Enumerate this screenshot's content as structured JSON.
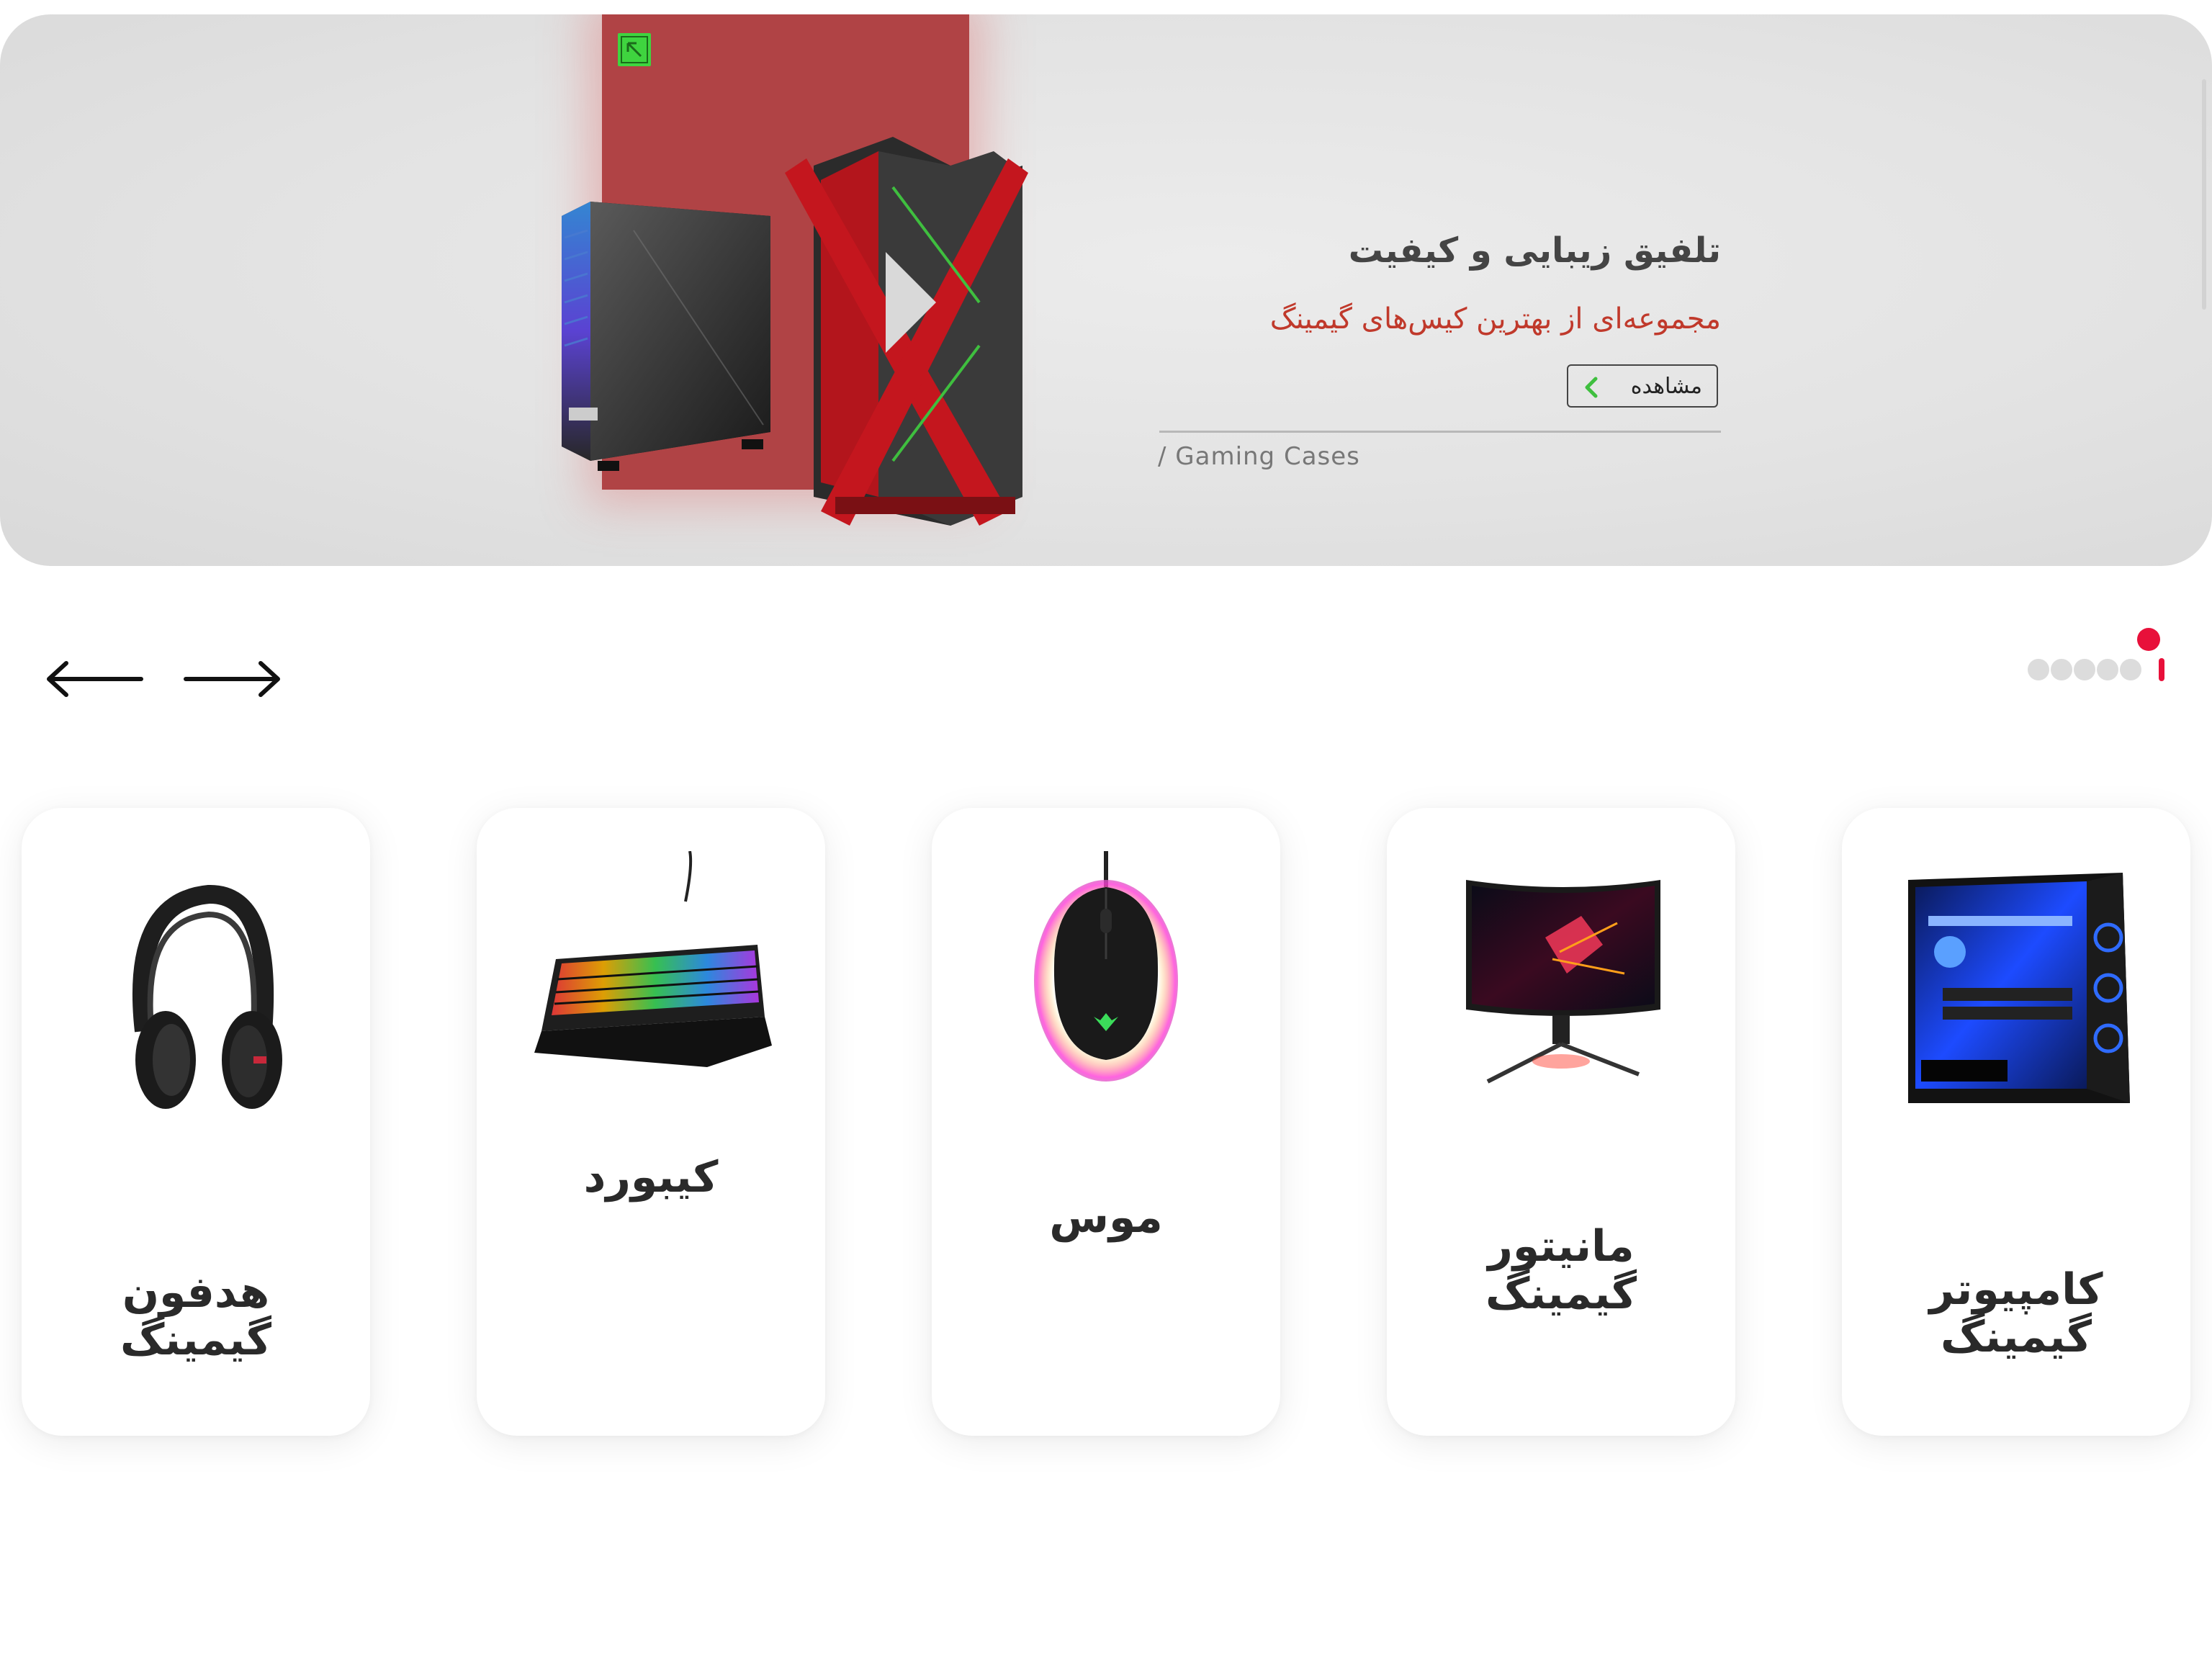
{
  "hero": {
    "title": "تلفیق زیبایی و کیفیت",
    "subtitle": "مجموعه‌ای از بهترین کیس‌های گیمینگ",
    "view_label": "مشاهده",
    "caption": "/ Gaming Cases",
    "accent_color": "#b04345",
    "subtitle_color": "#c0392b"
  },
  "carousel": {
    "prev_icon": "arrow-left-icon",
    "next_icon": "arrow-right-icon",
    "page_count": 6,
    "active_page": 6,
    "active_color": "#e8103a"
  },
  "categories": [
    {
      "label": "هدفون\nگیمینگ",
      "icon": "headphones-image"
    },
    {
      "label": "کیبورد",
      "icon": "keyboard-image"
    },
    {
      "label": "موس",
      "icon": "mouse-image"
    },
    {
      "label": "مانیتور\nگیمینگ",
      "icon": "monitor-image"
    },
    {
      "label": "کامپیوتر\nگیمینگ",
      "icon": "pc-case-image"
    }
  ]
}
